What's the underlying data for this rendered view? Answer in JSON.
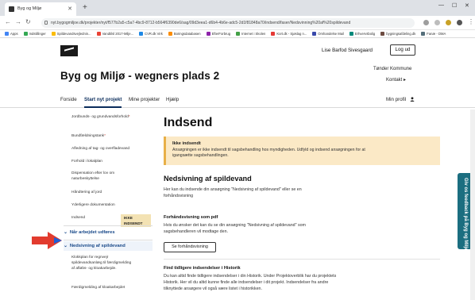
{
  "browser": {
    "tab_title": "Byg og Miljø",
    "new_tab_symbol": "+",
    "url": "nyt.bygogmiljoe.dk/projekter/nyt/f577b2a5-c5a7-4bc9-8712-b564f6390de6/sag/09d3eea1-d6b4-4b6e-adc5-2d1f81848a70/indsend/faser/Nedsvinning%20af%20spildevand",
    "bookmarks": [
      "Apps",
      "Indstillinger",
      "Spildevandsvejlednin...",
      "Vandtilsl 2017-Milje...",
      "CVR.dk Virk",
      "Boringsdatabasen",
      "EfterForbrug",
      "Internet i Skolen",
      "Kort.dk - Sjøslag n...",
      "Omhandelse Mail",
      "Erhvervsbolig",
      "bygningsafdeling.dk",
      "Fanæ - DMA"
    ]
  },
  "header": {
    "username": "Lise Barfod Sivesgaard",
    "logout_label": "Log ud",
    "site_title": "Byg og Miljø - wegners plads 2",
    "municipality": "Tønder Kommune",
    "contact_label": "Kontakt"
  },
  "nav": {
    "items": [
      "Forside",
      "Start nyt projekt",
      "Mine projekter",
      "Hjælp"
    ],
    "active": "Start nyt projekt",
    "profile_label": "Min profil"
  },
  "sidebar": {
    "items": [
      {
        "label": "Jordbunds- og grundvandsforhold",
        "required": true
      },
      {
        "label": "Bundfældningstank",
        "required": true
      },
      {
        "label": "Afledning af tag- og overfladevand",
        "required": false
      },
      {
        "label": "Forhold i lokalplan",
        "required": false
      },
      {
        "label": "Dispensation efter lov om naturbeskyttelse",
        "required": false
      },
      {
        "label": "Håndtering af jord",
        "required": false
      },
      {
        "label": "Yderligere dokumentation",
        "required": false
      },
      {
        "label": "Indsend",
        "required": false,
        "badge": "IKKE INDSENDT"
      }
    ],
    "section_completed": "Når arbejdet udføres",
    "section_active": "Nedsivning af spildevand",
    "sub_items": [
      "Klokkplan for regnvejr spildevandsanlæg til færdigmelding af afløbs- og kloakarbejde.",
      "Færdigmelding af kloakarbejdet"
    ]
  },
  "main": {
    "title": "Indsend",
    "alert_title": "Ikke indsendt",
    "alert_body": "Ansøgningen er ikke indsendt til sagsbehandling hos myndigheden. Udfyld og indsend ansøgningen for at igangsætte sagsbehandlingen.",
    "section_title": "Nedsivning af spildevand",
    "section_text": "Her kan du indsende din ansøgning \"Nedsivning af spildevand\" eller se en forhåndsvisning",
    "preview_title": "Forhåndsvisning som pdf",
    "preview_text": "Hvis du ønsker det kan du se din ansøgning \"Nedsivning af spildevand\" som sagsbehandleren vil modtage den.",
    "preview_button": "Se forhåndsvisning",
    "history_title": "Find tidligere indsendelser i Historik",
    "history_text": "Du kan altid finde tidligere indsendelser i din Historik. Under Projektoverblik har du projektets Historik. Her vil du altid kunne finde alle indsendelser i dit projekt. Indsendelser fra andre tilknyttede ansøgere vil også være listet i historikken."
  },
  "feedback_label": "Giv os feedback på Byg og Miljø",
  "colors": {
    "brand_dark": "#0b2d5c",
    "alert_bg": "#fbe9c6",
    "badge_bg": "#f3e2b3",
    "feedback_bg": "#1b6e80",
    "arrow_red": "#e23b2e",
    "arrow_blue": "#1e5fd6"
  }
}
